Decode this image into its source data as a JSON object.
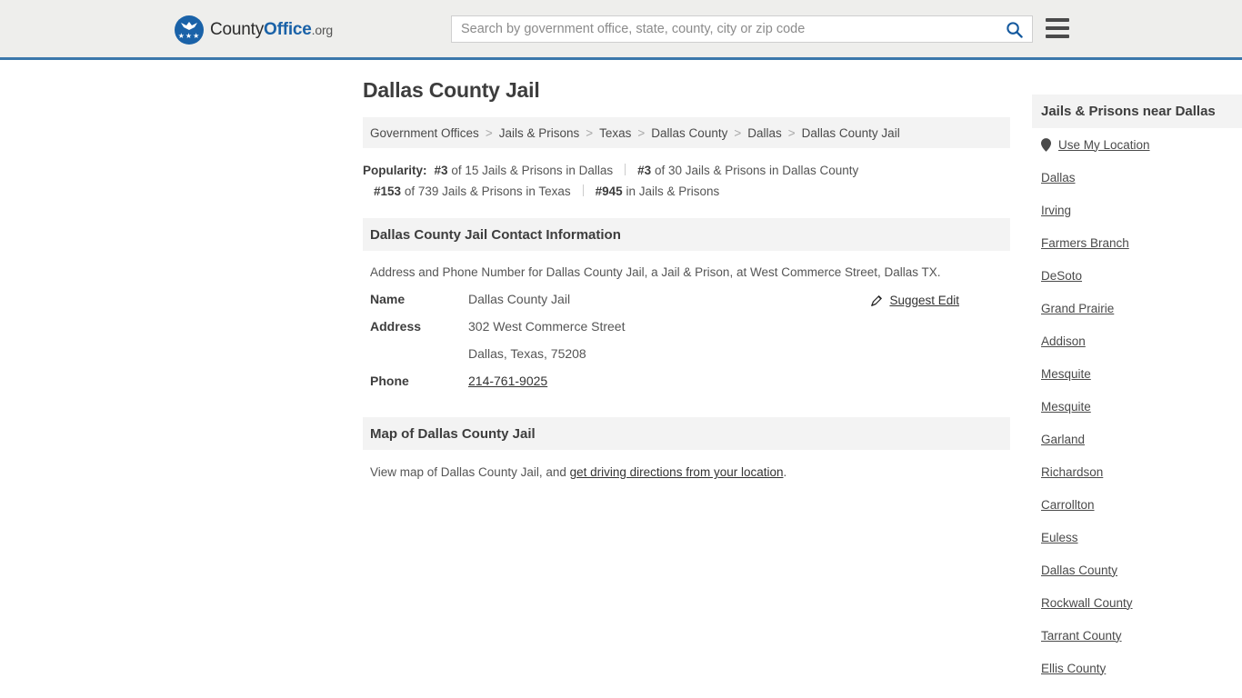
{
  "header": {
    "brand": {
      "part1": "County",
      "part2": "Office",
      "part3": ".org",
      "logo_icon": "eagle-stars-logo",
      "stars": "★★★"
    },
    "search": {
      "placeholder": "Search by government office, state, county, city or zip code",
      "value": "",
      "icon": "search-icon"
    },
    "menu": {
      "icon": "hamburger-menu-icon"
    },
    "accent_color": "#3b78ab"
  },
  "page": {
    "title": "Dallas County Jail"
  },
  "breadcrumb": {
    "separator": ">",
    "items": [
      {
        "label": "Government Offices"
      },
      {
        "label": "Jails & Prisons"
      },
      {
        "label": "Texas"
      },
      {
        "label": "Dallas County"
      },
      {
        "label": "Dallas"
      },
      {
        "label": "Dallas County Jail"
      }
    ]
  },
  "popularity": {
    "label": "Popularity:",
    "items": [
      {
        "rank": "#3",
        "text": "of 15 Jails & Prisons in Dallas"
      },
      {
        "rank": "#3",
        "text": "of 30 Jails & Prisons in Dallas County"
      },
      {
        "rank": "#153",
        "text": "of 739 Jails & Prisons in Texas"
      },
      {
        "rank": "#945",
        "text": "in Jails & Prisons"
      }
    ]
  },
  "contact": {
    "heading": "Dallas County Jail Contact Information",
    "description": "Address and Phone Number for Dallas County Jail, a Jail & Prison, at West Commerce Street, Dallas TX.",
    "suggest_edit": {
      "label": "Suggest Edit",
      "icon": "edit-pencil-icon"
    },
    "rows": [
      {
        "label": "Name",
        "value": "Dallas County Jail",
        "link": false
      },
      {
        "label": "Address",
        "value": "302 West Commerce Street",
        "link": false
      },
      {
        "label": "",
        "value": "Dallas, Texas, 75208",
        "link": false
      },
      {
        "label": "Phone",
        "value": "214-761-9025",
        "link": true
      }
    ]
  },
  "map": {
    "heading": "Map of Dallas County Jail",
    "text_before": "View map of Dallas County Jail, and ",
    "link_label": "get driving directions from your location",
    "text_after": "."
  },
  "sidebar": {
    "heading": "Jails & Prisons near Dallas",
    "use_my_location": {
      "label": "Use My Location",
      "icon": "map-pin-icon"
    },
    "items": [
      {
        "label": "Dallas"
      },
      {
        "label": "Irving"
      },
      {
        "label": "Farmers Branch"
      },
      {
        "label": "DeSoto"
      },
      {
        "label": "Grand Prairie"
      },
      {
        "label": "Addison"
      },
      {
        "label": "Mesquite"
      },
      {
        "label": "Mesquite"
      },
      {
        "label": "Garland"
      },
      {
        "label": "Richardson"
      },
      {
        "label": "Carrollton"
      },
      {
        "label": "Euless"
      },
      {
        "label": "Dallas County"
      },
      {
        "label": "Rockwall County"
      },
      {
        "label": "Tarrant County"
      },
      {
        "label": "Ellis County"
      }
    ]
  }
}
